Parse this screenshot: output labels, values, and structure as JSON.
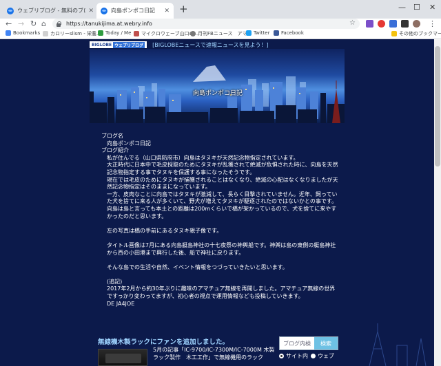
{
  "tabs": [
    {
      "title": "ウェブリブログ - 無料のブログ(blog)サ",
      "active": false
    },
    {
      "title": "向島ポンポコ日記",
      "active": true
    }
  ],
  "address": {
    "url": "https://tanukijima.at.webry.info"
  },
  "bookmarks": [
    {
      "label": "Bookmarks",
      "icon": "apps-grid-icon",
      "color": "#4285f4"
    },
    {
      "label": "カロリーslism - 栄養...",
      "icon": "slism-icon",
      "color": "#d0d0d0"
    },
    {
      "label": "Today / Me",
      "icon": "today-icon",
      "color": "#2e9b3f"
    },
    {
      "label": "マイクロウェーブ山口の...",
      "icon": "blog-icon",
      "color": "#c0504d"
    },
    {
      "label": "月刊FBニュース　アマ...",
      "icon": "globe-icon",
      "color": "#777"
    },
    {
      "label": "Twitter",
      "icon": "twitter-icon",
      "color": "#1da1f2"
    },
    {
      "label": "Facebook",
      "icon": "facebook-icon",
      "color": "#3b5998"
    },
    {
      "label": "その他のブックマーク",
      "icon": "folder-icon",
      "color": "#f4c20d"
    }
  ],
  "biglobe": {
    "logo": "BIGLOBE",
    "logo_blog": "ウェブリブログ",
    "news_link": "[BIGLOBEニュースで速報ニュースを見よう！]"
  },
  "blog": {
    "banner_title": "向島ポンポコ日記",
    "name_label": "ブログ名",
    "name_value": "向島ポンポコ日記",
    "intro_label": "ブログ紹介",
    "intro_text": "私が住んでる（山口県防府市）向島はタヌキが天然記念物指定されています。\n大正時代に日本中で毛皮採取のためにタヌキが乱獲されて絶滅が危惧された時に、向島を天然記念物指定する事でタヌキを保護する事になったそうです。\n現在では毛皮のためにタヌキが捕獲されることはなくなり、絶滅の心配はなくなりましたが天然記念物指定はそのままになっています。\n一方、皮肉なことに向島ではタヌキが激減して、長らく目撃されていません。近年、飼っていた犬を捨てに来る人が多くいて、野犬が増えてタヌキが駆逐されたのではないかとの事です。\n向島は島と言っても本土との距離は200mくらいで橋が架かっているので、犬を捨てに来やすかったのだと思います。\n\n左の写真は橋の手前にあるタヌキ親子像です。\n\nタイトル画像は7月にある向島艇島神社の十七夜祭の神輿船です。神輿は島の東側の艇島神社から西の小田港まで興行した後、船で神社に戻ります。\n\nそんな島での生活や自然、イベント情報をつづっていきたいと思います。\n\n(追記)\n2017年2月から約30年ぶりに趣味のアマチュア無線を再開しました。アマチュア無線の世界ですっかり変わってますが、初心者の視点で運用情報なども投稿していきます。\nDE JA4JOE"
  },
  "article": {
    "title": "無線機木製ラックにファンを追加しました。",
    "text": "5月の記事「IC-9700/IC-7300M/IC-7000M 木製ラック製作　木工工作」で無線機用のラック"
  },
  "search": {
    "placeholder": "ブログ内検",
    "button": "検索",
    "option_site": "サイト内",
    "option_web": "ウェブ"
  },
  "colors": {
    "page_bg": "#0c1a4b",
    "link": "#9fd4ff",
    "search_button": "#6ec1e4"
  }
}
